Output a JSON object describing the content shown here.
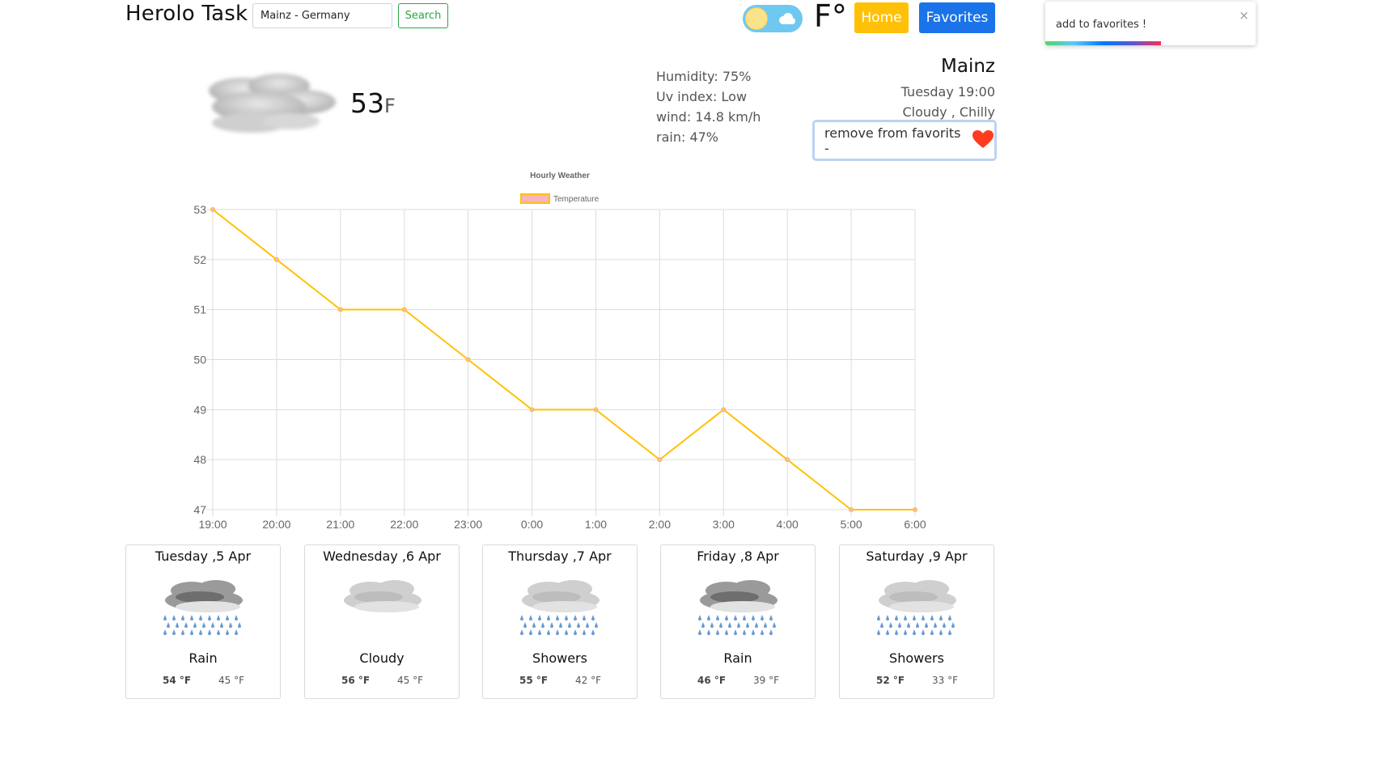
{
  "header": {
    "brand": "Herolo Task",
    "search_value": "Mainz - Germany",
    "search_label": "Search",
    "unit_label": "F°",
    "home_label": "Home",
    "favorites_label": "Favorites"
  },
  "toast": {
    "message": "add to favorites !",
    "close": "×",
    "progress": 0.55
  },
  "current": {
    "temp": "53",
    "unit": "F",
    "icon": "cloud-icon",
    "humidity": "Humidity: 75%",
    "uv": "Uv index: Low",
    "wind": "wind: 14.8 km/h",
    "rain": "rain: 47%",
    "city": "Mainz",
    "time": "Tuesday 19:00",
    "condition": "Cloudy , Chilly",
    "favorite_label": "remove from favorits -"
  },
  "colors": {
    "line": "#ffc107",
    "legend_fill": "#f8b4c0",
    "home": "#ffc107",
    "favorites": "#1a73e8",
    "search": "#28a745"
  },
  "chart_data": {
    "type": "line",
    "title": "Hourly Weather",
    "legend_position": "top",
    "grid": true,
    "categories": [
      "19:00",
      "20:00",
      "21:00",
      "22:00",
      "23:00",
      "0:00",
      "1:00",
      "2:00",
      "3:00",
      "4:00",
      "5:00",
      "6:00"
    ],
    "series": [
      {
        "name": "Temperature",
        "values": [
          53,
          52,
          51,
          51,
          50,
          49,
          49,
          48,
          49,
          48,
          47,
          47
        ]
      }
    ],
    "ylim": [
      47,
      53
    ],
    "yticks": [
      "53",
      "52",
      "51",
      "50",
      "49",
      "48",
      "47"
    ]
  },
  "forecast": [
    {
      "date": "Tuesday ,5 Apr",
      "condition": "Rain",
      "high": "54 °F",
      "low": "45 °F",
      "icon": "rain-icon"
    },
    {
      "date": "Wednesday ,6 Apr",
      "condition": "Cloudy",
      "high": "56 °F",
      "low": "45 °F",
      "icon": "cloud-icon"
    },
    {
      "date": "Thursday ,7 Apr",
      "condition": "Showers",
      "high": "55 °F",
      "low": "42 °F",
      "icon": "showers-icon"
    },
    {
      "date": "Friday ,8 Apr",
      "condition": "Rain",
      "high": "46 °F",
      "low": "39 °F",
      "icon": "rain-icon"
    },
    {
      "date": "Saturday ,9 Apr",
      "condition": "Showers",
      "high": "52 °F",
      "low": "33 °F",
      "icon": "showers-icon"
    }
  ]
}
